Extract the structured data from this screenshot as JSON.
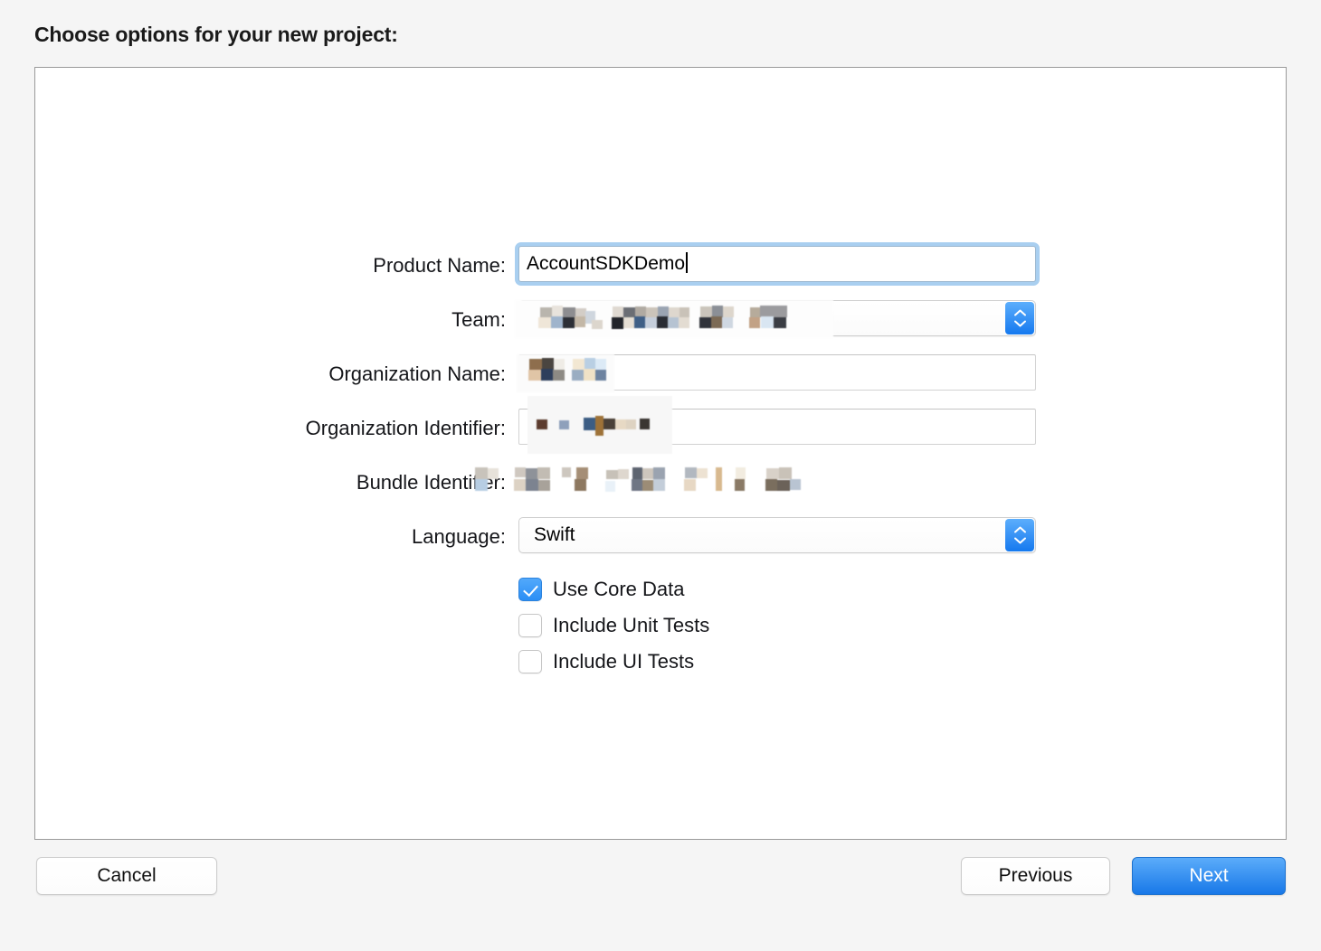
{
  "dialog": {
    "title": "Choose options for your new project:"
  },
  "form": {
    "rows": [
      {
        "label": "Product Name:",
        "control": "textfield-focused",
        "value": "AccountSDKDemo",
        "redacted": false
      },
      {
        "label": "Team:",
        "control": "popup",
        "value": "",
        "redacted": true
      },
      {
        "label": "Organization Name:",
        "control": "textfield",
        "value": "",
        "redacted": true
      },
      {
        "label": "Organization Identifier:",
        "control": "textfield",
        "value": "",
        "redacted": true
      },
      {
        "label": "Bundle Identifier:",
        "control": "static",
        "value": "",
        "redacted": true
      },
      {
        "label": "Language:",
        "control": "popup",
        "value": "Swift",
        "redacted": false
      }
    ]
  },
  "options": {
    "checkboxes": [
      {
        "label": "Use Core Data",
        "checked": true
      },
      {
        "label": "Include Unit Tests",
        "checked": false
      },
      {
        "label": "Include UI Tests",
        "checked": false
      }
    ]
  },
  "footer": {
    "cancel_label": "Cancel",
    "previous_label": "Previous",
    "next_label": "Next"
  },
  "colors": {
    "accent_blue": "#1878e8",
    "focus_ring": "#a9cff0",
    "checkbox_checked": "#2b8ef5",
    "page_background": "#f5f5f5",
    "panel_border": "#9a9a9a"
  },
  "icons": {
    "stepper_up": "chevron-up-icon",
    "stepper_down": "chevron-down-icon",
    "checkmark": "checkmark-icon"
  }
}
